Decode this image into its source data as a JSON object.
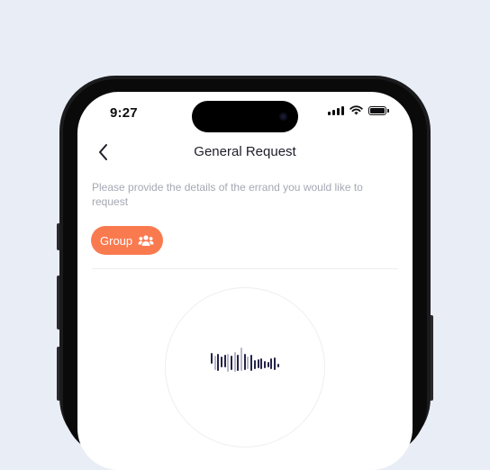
{
  "status_bar": {
    "time": "9:27"
  },
  "header": {
    "title": "General Request"
  },
  "description": "Please provide the details of the errand you would like to request",
  "chip": {
    "label": "Group",
    "icon": "group-icon"
  },
  "icons": {
    "back": "chevron-left-icon",
    "wifi": "wifi-icon",
    "signal": "signal-icon",
    "battery": "battery-icon",
    "waveform": "waveform-icon"
  },
  "colors": {
    "accent": "#fa7a4f",
    "title": "#1e1e2a",
    "muted_text": "#a5a8b4",
    "wave_dark": "#25244a",
    "wave_light": "#b7b8c8"
  }
}
